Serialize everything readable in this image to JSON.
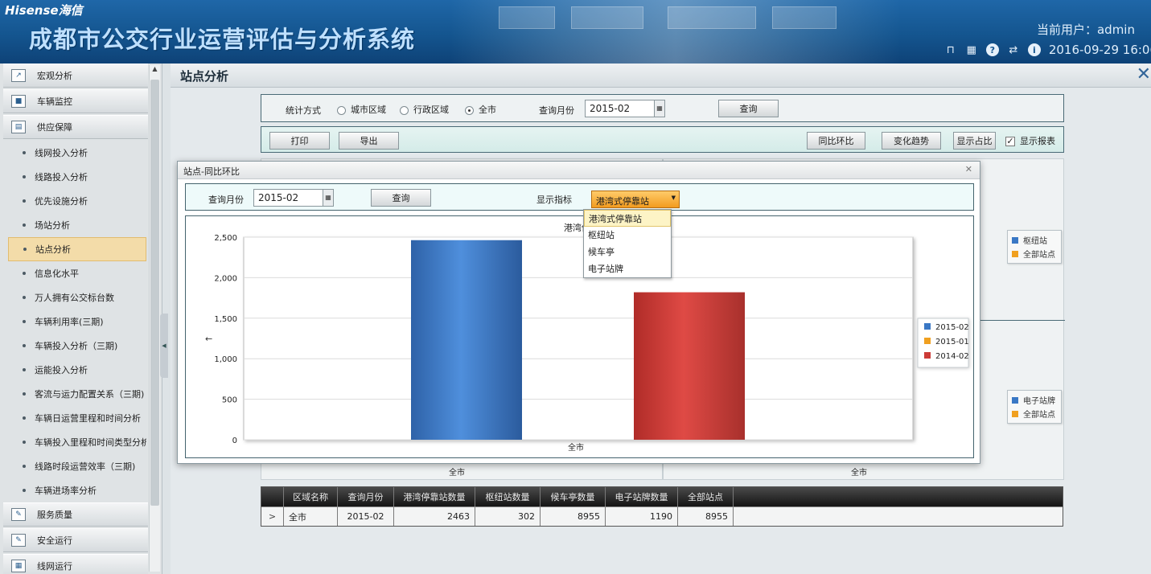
{
  "header": {
    "brand": "Hisense海信",
    "system_title": "成都市公交行业运营评估与分析系统",
    "current_user": "当前用户：admin",
    "datetime": "2016-09-29 16:06"
  },
  "sidebar": {
    "categories": [
      {
        "label": "宏观分析",
        "icon": "chart-icon"
      },
      {
        "label": "车辆监控",
        "icon": "monitor-icon"
      },
      {
        "label": "供应保障",
        "icon": "supply-icon"
      }
    ],
    "items": [
      "线网投入分析",
      "线路投入分析",
      "优先设施分析",
      "场站分析",
      "站点分析",
      "信息化水平",
      "万人拥有公交标台数",
      "车辆利用率(三期)",
      "车辆投入分析（三期)",
      "运能投入分析",
      "客流与运力配置关系（三期)",
      "车辆日运营里程和时间分析",
      "车辆投入里程和时间类型分析",
      "线路时段运营效率（三期)",
      "车辆进场率分析"
    ],
    "active_item": "站点分析",
    "bottom_categories": [
      {
        "label": "服务质量",
        "icon": "service-icon"
      },
      {
        "label": "安全运行",
        "icon": "safety-icon"
      },
      {
        "label": "线网运行",
        "icon": "network-icon"
      }
    ]
  },
  "page": {
    "title": "站点分析",
    "filters": {
      "stat_method_label": "统计方式",
      "options": [
        "城市区域",
        "行政区域",
        "全市"
      ],
      "selected_option": "全市",
      "month_label": "查询月份",
      "month_value": "2015-02",
      "query_button": "查询"
    },
    "toolbar": {
      "print": "打印",
      "export": "导出",
      "yoy": "同比环比",
      "trend": "变化趋势",
      "ratio": "显示占比",
      "show_report": "显示报表",
      "show_report_checked": true
    },
    "bg_legend_top": [
      "枢纽站",
      "全部站点"
    ],
    "bg_legend_bottom": [
      "电子站牌",
      "全部站点"
    ],
    "bg_xlabel": "全市",
    "table": {
      "columns": [
        "区域名称",
        "查询月份",
        "港湾停靠站数量",
        "枢纽站数量",
        "候车亭数量",
        "电子站牌数量",
        "全部站点"
      ],
      "rows": [
        [
          "全市",
          "2015-02",
          "2463",
          "302",
          "8955",
          "1190",
          "8955"
        ]
      ]
    }
  },
  "modal": {
    "title": "站点-同比环比",
    "month_label": "查询月份",
    "month_value": "2015-02",
    "query_button": "查询",
    "indicator_label": "显示指标",
    "indicator_selected": "港湾式停靠站",
    "indicator_options": [
      "港湾式停靠站",
      "枢纽站",
      "候车亭",
      "电子站牌"
    ],
    "chart_title_visible": "港湾停"
  },
  "colors": {
    "bar_2015_02": "#3a78c5",
    "bar_2015_01": "#f0a020",
    "bar_2014_02": "#cc3b37",
    "header_blue": "#14558f"
  },
  "chart_data": {
    "type": "bar",
    "title": "港湾停",
    "categories": [
      "全市"
    ],
    "series": [
      {
        "name": "2015-02",
        "values": [
          2463
        ]
      },
      {
        "name": "2015-01",
        "values": [
          0
        ]
      },
      {
        "name": "2014-02",
        "values": [
          1820
        ]
      }
    ],
    "yticks": [
      "0",
      "500",
      "1,000",
      "1,500",
      "2,000",
      "2,500"
    ],
    "ylim": [
      0,
      2500
    ],
    "ylabel_arrow": "←",
    "grid": true,
    "legend": "right"
  }
}
